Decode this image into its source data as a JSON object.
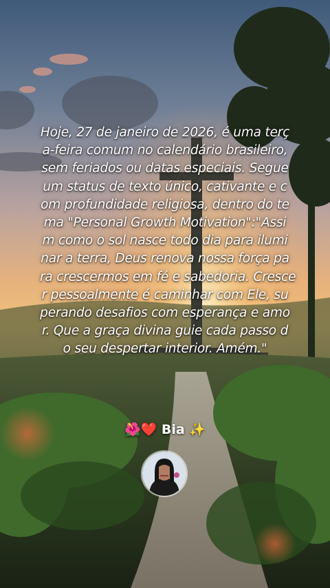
{
  "quote": {
    "lines": [
      "Hoje, 27 de janeiro de 2026, é uma terç",
      "a-feira comum no calendário brasileiro,",
      "sem feriados ou datas especiais. Segue",
      "um status de texto único, cativante e c",
      "om profundidade religiosa, dentro do te",
      "ma \"Personal Growth Motivation\":\"Assi",
      "m como o sol nasce todo dia para ilumi",
      "nar a terra, Deus renova nossa força pa",
      "ra crescermos em fé e sabedoria. Cresce",
      "r pessoalmente é caminhar com Ele, su",
      "perando desafios com esperança e amo",
      "r. Que a graça divina guie cada passo d",
      "o seu despertar interior. Amém.\""
    ]
  },
  "signature": {
    "prefix": "🌺❤️",
    "name": "Bia",
    "suffix": "✨"
  },
  "icons": {
    "avatar": "profile-photo"
  }
}
